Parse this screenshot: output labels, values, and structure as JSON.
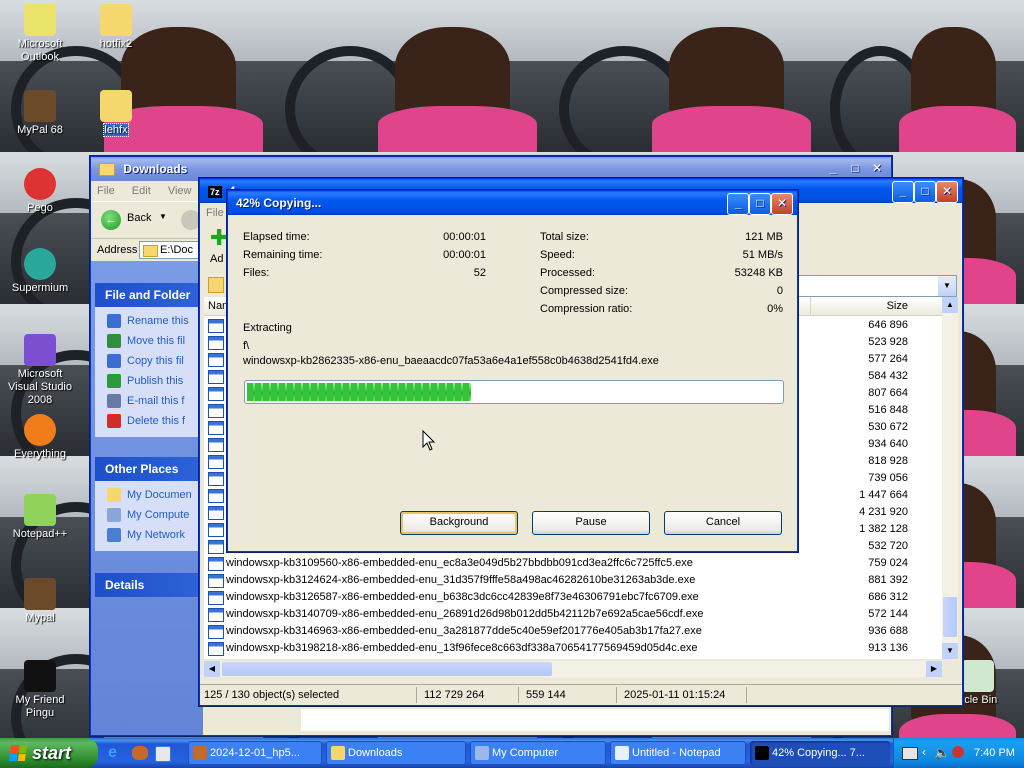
{
  "desktop": {
    "icons": [
      {
        "label": "Microsoft Outlook",
        "icon": "outlook-icon"
      },
      {
        "label": "hotfix2",
        "icon": "folder-icon"
      },
      {
        "label": "MyPal 68",
        "icon": "mypal-icon"
      },
      {
        "label": "lehfx",
        "icon": "folder-icon"
      },
      {
        "label": "Pego",
        "icon": "pego-icon"
      },
      {
        "label": "Supermium",
        "icon": "supermium-icon"
      },
      {
        "label": "Microsoft Visual Studio 2008",
        "icon": "visual-studio-icon"
      },
      {
        "label": "Everything",
        "icon": "everything-icon"
      },
      {
        "label": "Notepad++",
        "icon": "notepadpp-icon"
      },
      {
        "label": "Mypal",
        "icon": "mypal-icon"
      },
      {
        "label": "My Friend Pingu",
        "icon": "pingu-icon"
      },
      {
        "label": "ycle Bin",
        "icon": "recycle-bin-icon"
      }
    ]
  },
  "explorer": {
    "title": "Downloads",
    "menu": [
      "File",
      "Edit",
      "View"
    ],
    "back_label": "Back",
    "address_label": "Address",
    "address_value": "E:\\Doc",
    "tasks_header": "File and Folder",
    "tasks": [
      "Rename this",
      "Move this fil",
      "Copy this fil",
      "Publish this",
      "E-mail this f",
      "Delete this f"
    ],
    "places_header": "Other Places",
    "places": [
      "My Documen",
      "My Compute",
      "My Network"
    ],
    "details_header": "Details"
  },
  "archive_window": {
    "title_prefix": "7z",
    "title_fragment": "4",
    "menu_fragment": "File",
    "add_fragment": "Ad",
    "name_col": "Nam",
    "size_col": "Size",
    "files": [
      {
        "name": "",
        "size": "646 896"
      },
      {
        "name": "",
        "size": "523 928"
      },
      {
        "name": "",
        "size": "577 264"
      },
      {
        "name": "",
        "size": "584 432"
      },
      {
        "name": "",
        "size": "807 664"
      },
      {
        "name": "",
        "size": "516 848"
      },
      {
        "name": "",
        "size": "530 672"
      },
      {
        "name": "",
        "size": "934 640"
      },
      {
        "name": "",
        "size": "818 928"
      },
      {
        "name": "",
        "size": "739 056"
      },
      {
        "name": "",
        "size": "1 447 664"
      },
      {
        "name": "",
        "size": "4 231 920"
      },
      {
        "name": "",
        "size": "1 382 128"
      },
      {
        "name": "",
        "size": "532 720"
      },
      {
        "name": "windowsxp-kb3109560-x86-embedded-enu_ec8a3e049d5b27bbdbb091cd3ea2ffc6c725ffc5.exe",
        "size": "759 024"
      },
      {
        "name": "windowsxp-kb3124624-x86-embedded-enu_31d357f9fffe58a498ac46282610be31263ab3de.exe",
        "size": "881 392"
      },
      {
        "name": "windowsxp-kb3126587-x86-embedded-enu_b638c3dc6cc42839e8f73e46306791ebc7fc6709.exe",
        "size": "686 312"
      },
      {
        "name": "windowsxp-kb3140709-x86-embedded-enu_26891d26d98b012dd5b42112b7e692a5cae56cdf.exe",
        "size": "572 144"
      },
      {
        "name": "windowsxp-kb3146963-x86-embedded-enu_3a281877dde5c40e59ef201776e405ab3b17fa27.exe",
        "size": "936 688"
      },
      {
        "name": "windowsxp-kb3198218-x86-embedded-enu_13f96fece8c663df338a70654177569459d05d4c.exe",
        "size": "913 136"
      }
    ],
    "status": {
      "selected": "125 / 130 object(s) selected",
      "total_size": "112 729 264",
      "sel_size": "559 144",
      "modified": "2025-01-11 01:15:24"
    }
  },
  "copy_dialog": {
    "title": "42% Copying...",
    "elapsed_label": "Elapsed time:",
    "elapsed_value": "00:00:01",
    "remaining_label": "Remaining time:",
    "remaining_value": "00:00:01",
    "files_label": "Files:",
    "files_value": "52",
    "total_label": "Total size:",
    "total_value": "121 MB",
    "speed_label": "Speed:",
    "speed_value": "51 MB/s",
    "processed_label": "Processed:",
    "processed_value": "53248 KB",
    "compressed_label": "Compressed size:",
    "compressed_value": "0",
    "ratio_label": "Compression ratio:",
    "ratio_value": "0%",
    "operation": "Extracting",
    "path": "f\\",
    "current_file": "windowsxp-kb2862335-x86-enu_baeaacdc07fa53a6e4a1ef558c0b4638d2541fd4.exe",
    "progress_fraction": 0.42,
    "background_button": "Background",
    "pause_button": "Pause",
    "cancel_button": "Cancel"
  },
  "taskbar": {
    "start_label": "start",
    "tasks": [
      {
        "label": "2024-12-01_hp5...",
        "icon": "media-player-icon"
      },
      {
        "label": "Downloads",
        "icon": "folder-icon"
      },
      {
        "label": "My Computer",
        "icon": "computer-icon"
      },
      {
        "label": "Untitled - Notepad",
        "icon": "notepad-icon"
      },
      {
        "label": "42% Copying... 7...",
        "icon": "7zip-icon"
      }
    ],
    "clock": "7:40 PM"
  }
}
